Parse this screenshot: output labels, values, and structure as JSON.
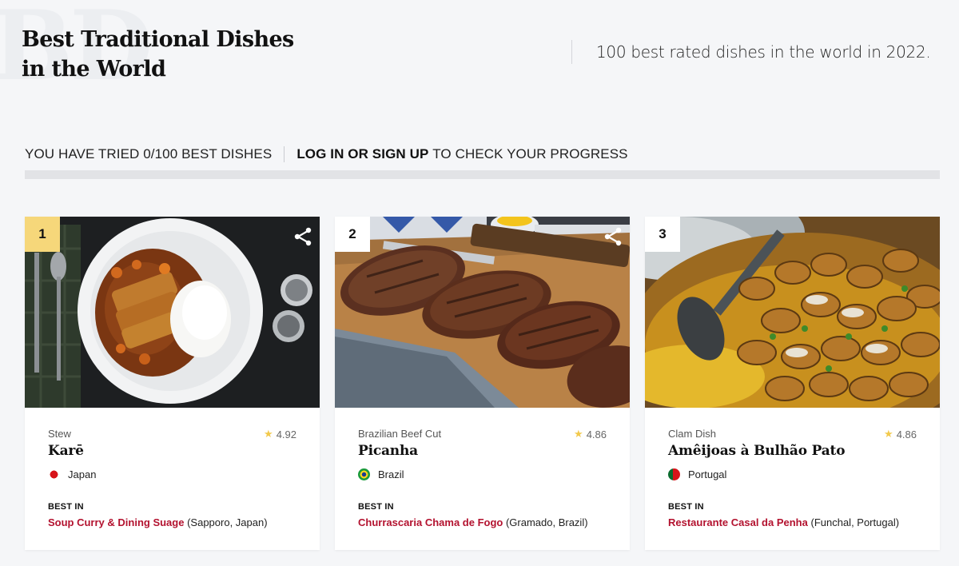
{
  "header": {
    "watermark": "BD",
    "title": "Best Traditional Dishes in the World",
    "subtitle": "100 best rated dishes in the world in 2022."
  },
  "progress": {
    "tried_text": "YOU HAVE TRIED 0/100 BEST DISHES",
    "login_link": "LOG IN OR SIGN UP",
    "suffix": "TO CHECK YOUR PROGRESS",
    "tried": 0,
    "total": 100
  },
  "colors": {
    "accent": "#b3122f",
    "rank_gold": "#f6d77a",
    "star": "#f2c94c"
  },
  "cards": [
    {
      "rank": "1",
      "category": "Stew",
      "rating": "4.92",
      "name": "Karē",
      "country": "Japan",
      "flag_icon": "japan-flag-icon",
      "best_in_label": "BEST IN",
      "restaurant": "Soup Curry & Dining Suage",
      "location": "(Sapporo, Japan)"
    },
    {
      "rank": "2",
      "category": "Brazilian Beef Cut",
      "rating": "4.86",
      "name": "Picanha",
      "country": "Brazil",
      "flag_icon": "brazil-flag-icon",
      "best_in_label": "BEST IN",
      "restaurant": "Churrascaria Chama de Fogo",
      "location": "(Gramado, Brazil)"
    },
    {
      "rank": "3",
      "category": "Clam Dish",
      "rating": "4.86",
      "name": "Amêijoas à Bulhão Pato",
      "country": "Portugal",
      "flag_icon": "portugal-flag-icon",
      "best_in_label": "BEST IN",
      "restaurant": "Restaurante Casal da Penha",
      "location": "(Funchal, Portugal)"
    }
  ]
}
